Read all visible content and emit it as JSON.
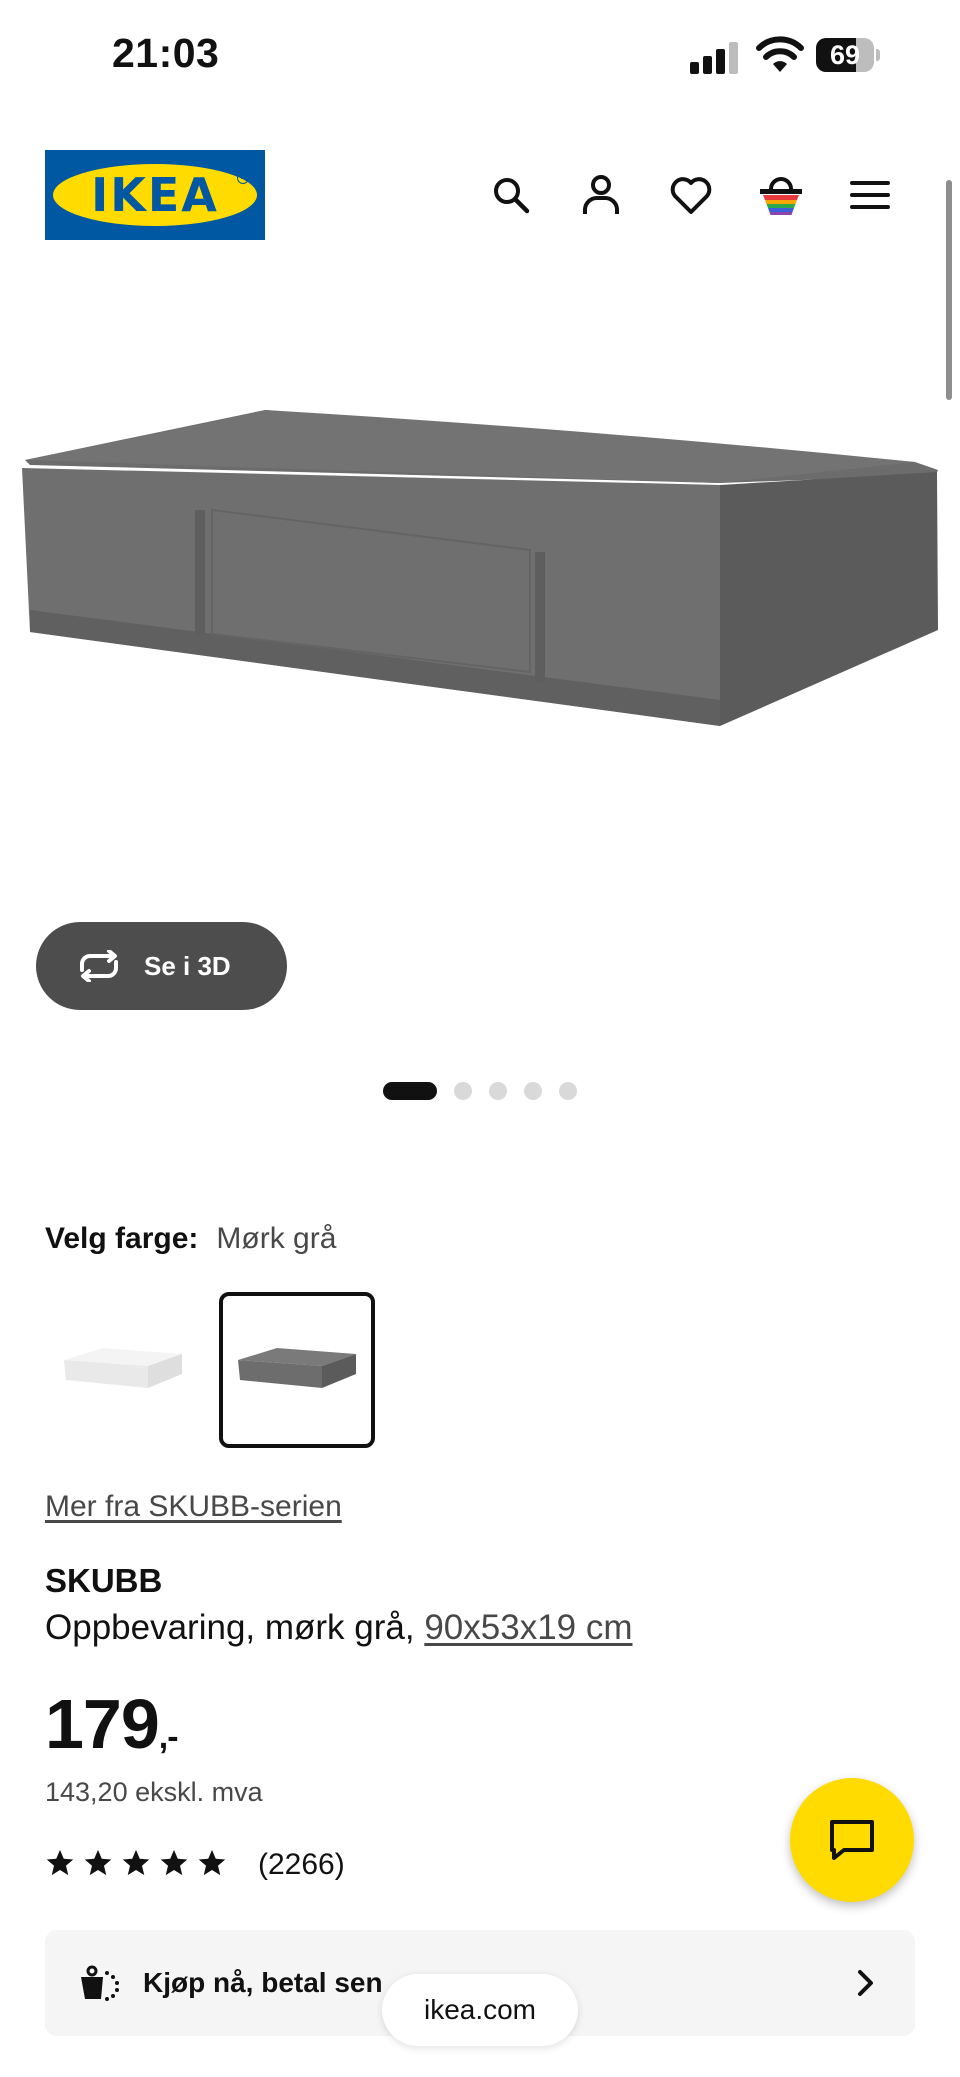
{
  "status_bar": {
    "time": "21:03",
    "battery": "69",
    "battery_level": 0.69
  },
  "header": {
    "logo_text": "IKEA",
    "icons": [
      "search-icon",
      "account-icon",
      "heart-icon",
      "basket-icon",
      "menu-icon"
    ]
  },
  "gallery": {
    "view_3d_label": "Se i 3D",
    "dot_count": 5,
    "active_index": 0
  },
  "color_picker": {
    "label": "Velg farge:",
    "selected": "Mørk grå",
    "options": [
      "hvit",
      "mørk grå"
    ]
  },
  "product": {
    "series_link": "Mer fra SKUBB-serien",
    "name": "SKUBB",
    "description": "Oppbevaring, mørk grå,",
    "dimensions": "90x53x19 cm",
    "price_int": "179",
    "price_suffix": ",-",
    "price_ex_vat": "143,20 ekskl. mva",
    "rating_stars": 5,
    "rating_count": "(2266)"
  },
  "klarna": {
    "label": "Kjøp nå, betal sen"
  },
  "browser": {
    "url": "ikea.com"
  },
  "colors": {
    "ikea_blue": "#0058a3",
    "ikea_yellow": "#ffdb00",
    "button_dark": "#4d4d4d"
  }
}
